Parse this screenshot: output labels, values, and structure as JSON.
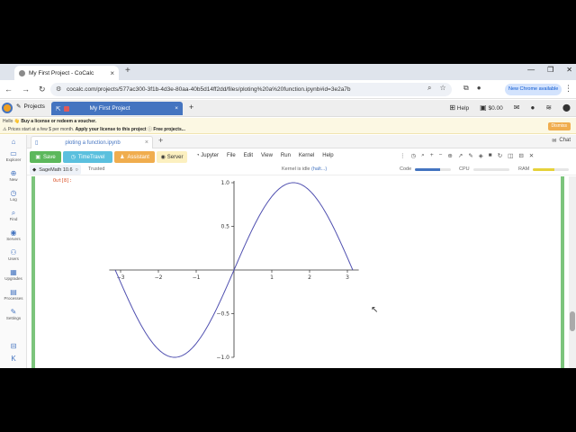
{
  "browser": {
    "tab_title": "My First Project - CoCalc",
    "url": "cocalc.com/projects/577ac300-3f1b-4d3e-80aa-40b5d14ff2dd/files/ploting%20a%20function.ipynb#id=3e2a7b",
    "update_button": "New Chrome available"
  },
  "cocalc": {
    "projects_label": "Projects",
    "project_tab_title": "My First Project",
    "help_label": "Help",
    "balance": "$0.00"
  },
  "banner": {
    "line1_prefix": "Hello 👋",
    "line1_link": "Buy a license or redeem a voucher.",
    "line2_prefix": "Prices start at a few $ per month.",
    "line2_link": "Apply your license to this project",
    "line2_suffix": "Free projects...",
    "dismiss": "Dismiss"
  },
  "sidebar": {
    "items": [
      {
        "label": "Explorer"
      },
      {
        "label": "New"
      },
      {
        "label": "Log"
      },
      {
        "label": "Find"
      },
      {
        "label": "Servers"
      },
      {
        "label": "Users"
      },
      {
        "label": "Upgrades"
      },
      {
        "label": "Processes"
      },
      {
        "label": "Settings"
      }
    ]
  },
  "file_tab": {
    "title": "ploting a function.ipynb",
    "chat_label": "Chat"
  },
  "toolbar": {
    "save": "Save",
    "timetravel": "TimeTravel",
    "assistant": "Assistant",
    "server": "Server",
    "menus": [
      "Jupyter",
      "File",
      "Edit",
      "View",
      "Run",
      "Kernel",
      "Help"
    ]
  },
  "status": {
    "kernel_name": "SageMath 10.6",
    "trusted": "Trusted",
    "kernel_state": "Kernel is idle",
    "halt": "(halt...)",
    "code_label": "Code",
    "cpu_label": "CPU",
    "ram_label": "RAM",
    "code_level": 0.7,
    "cpu_level": 0.0,
    "ram_level": 0.6
  },
  "cell": {
    "out_prompt": "Out[8]:"
  },
  "chart_data": {
    "type": "line",
    "function": "sin(x)",
    "x_range": [
      -3.14159,
      3.14159
    ],
    "xlim": [
      -3.3,
      3.3
    ],
    "ylim": [
      -1.0,
      1.0
    ],
    "x_ticks": [
      -3,
      -2,
      -1,
      1,
      2,
      3
    ],
    "y_ticks": [
      1.0,
      0.5,
      -0.5,
      -1.0
    ],
    "x_tick_labels": [
      "−3",
      "−2",
      "−1",
      "1",
      "2",
      "3"
    ],
    "y_tick_labels": [
      "1.0",
      "0.5",
      "−0.5",
      "−1.0"
    ],
    "line_color": "#5050b0",
    "grid": false
  }
}
